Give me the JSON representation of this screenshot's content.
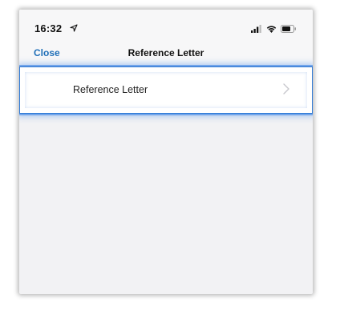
{
  "status_bar": {
    "time": "16:32",
    "icons": [
      "location-arrow-icon",
      "signal-icon",
      "wifi-icon",
      "battery-icon"
    ]
  },
  "nav_bar": {
    "close_label": "Close",
    "title": "Reference Letter"
  },
  "list": {
    "items": [
      {
        "label": "Reference Letter",
        "icon": "chevron-right-icon"
      }
    ]
  },
  "colors": {
    "accent": "#1f6fb8",
    "highlight": "#2f7ad6",
    "background": "#f2f2f4"
  }
}
